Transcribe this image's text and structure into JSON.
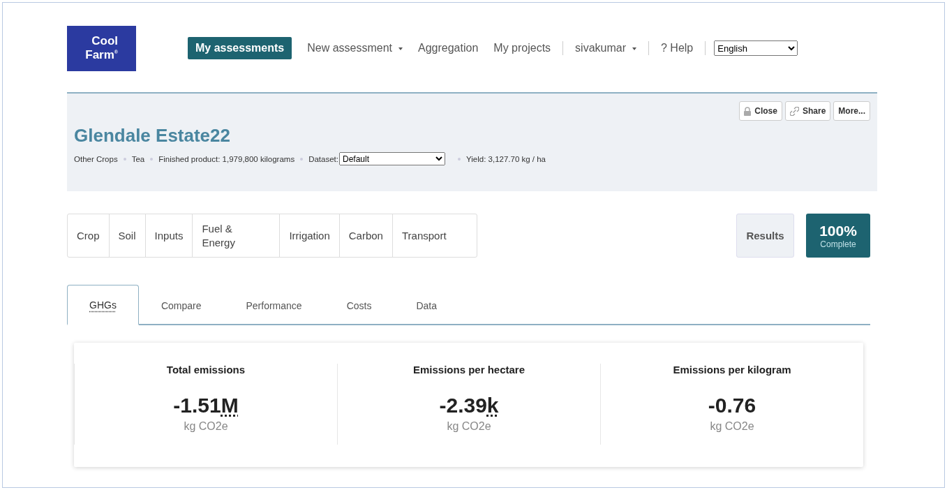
{
  "logo": {
    "line_1": "Cool",
    "line_2": "Farm",
    "mark": "®"
  },
  "nav": {
    "items": [
      {
        "label": "My assessments",
        "selected": true,
        "dropdown": false
      },
      {
        "label": "New assessment",
        "selected": false,
        "dropdown": true
      },
      {
        "label": "Aggregation",
        "selected": false,
        "dropdown": false
      },
      {
        "label": "My projects",
        "selected": false,
        "dropdown": false
      }
    ],
    "user": {
      "label": "sivakumar",
      "dropdown": true
    },
    "help": "? Help",
    "language": "English"
  },
  "project": {
    "title": "Glendale Estate22",
    "meta": [
      "Other Crops",
      "Tea",
      "Finished product: 1,979,800 kilograms"
    ],
    "dataset_label": "Dataset:",
    "dataset": "Default",
    "yield": "Yield: 3,127.70 kg / ha",
    "actions": [
      {
        "label": "Close",
        "kind": "lock"
      },
      {
        "label": "Share",
        "kind": "link"
      },
      {
        "label": "More...",
        "kind": "plain"
      }
    ]
  },
  "steps": [
    "Crop",
    "Soil",
    "Inputs",
    "Fuel & Energy",
    "Irrigation",
    "Carbon",
    "Transport"
  ],
  "results_button": "Results",
  "completion": {
    "value": "100%",
    "label": "Complete"
  },
  "result_tabs": [
    {
      "label": "GHGs",
      "selected": true,
      "abbr": true
    },
    {
      "label": "Compare",
      "selected": false,
      "abbr": false
    },
    {
      "label": "Performance",
      "selected": false,
      "abbr": false
    },
    {
      "label": "Costs",
      "selected": false,
      "abbr": false
    },
    {
      "label": "Data",
      "selected": false,
      "abbr": false
    }
  ],
  "stats": [
    {
      "title": "Total emissions",
      "value": "-1.51",
      "suffix": "M",
      "unit": "kg CO2e"
    },
    {
      "title": "Emissions per hectare",
      "value": "-2.39",
      "suffix": "k",
      "unit": "kg CO2e"
    },
    {
      "title": "Emissions per kilogram",
      "value": "-0.76",
      "unit": "kg CO2e"
    }
  ]
}
